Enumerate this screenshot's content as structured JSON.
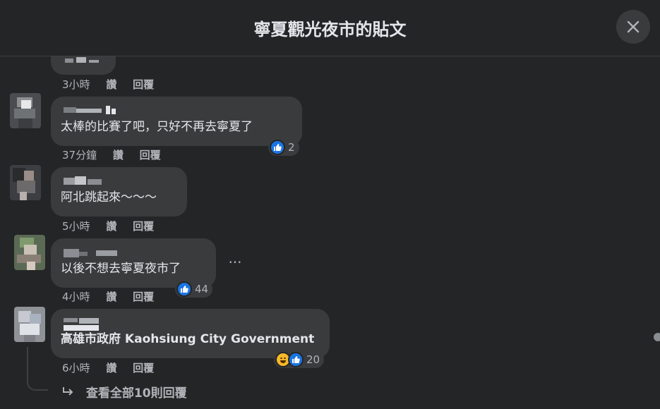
{
  "header": {
    "title": "寧夏觀光夜市的貼文"
  },
  "comments": [
    {
      "time": "3小時",
      "like_label": "讚",
      "reply_label": "回覆"
    },
    {
      "text": "太棒的比賽了吧，只好不再去寧夏了",
      "time": "37分鐘",
      "like_label": "讚",
      "reply_label": "回覆",
      "reaction_count": "2"
    },
    {
      "text": "阿北跳起來～～～",
      "time": "5小時",
      "like_label": "讚",
      "reply_label": "回覆"
    },
    {
      "text": "以後不想去寧夏夜市了",
      "time": "4小時",
      "like_label": "讚",
      "reply_label": "回覆",
      "reaction_count": "44"
    },
    {
      "text": "高雄市政府 Kaohsiung City Government",
      "time": "6小時",
      "like_label": "讚",
      "reply_label": "回覆",
      "reaction_count": "20"
    }
  ],
  "more_options": "···",
  "view_replies": "查看全部10則回覆",
  "colors": {
    "background": "#242526",
    "bubble": "#3a3b3c",
    "like_blue": "#1b74e4",
    "haha_yellow": "#f7b928"
  },
  "icons": {
    "close": "close-icon",
    "like": "like-icon",
    "haha": "haha-icon",
    "reply_arrow": "reply-arrow-icon"
  }
}
